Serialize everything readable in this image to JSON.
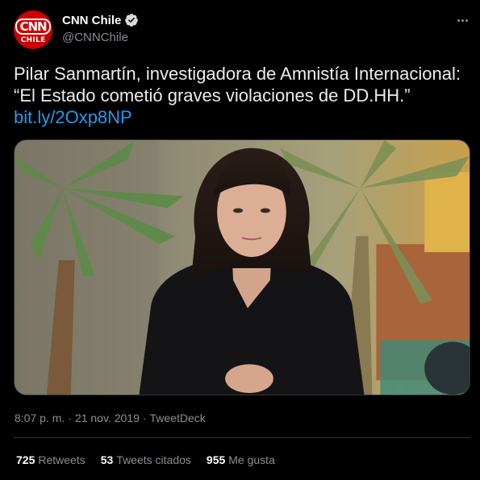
{
  "author": {
    "avatar_text_top": "CNN",
    "avatar_text_bottom": "CHILE",
    "display_name": "CNN Chile",
    "handle": "@CNNChile",
    "verified": true
  },
  "tweet": {
    "text": "Pilar Sanmartín, investigadora de Amnistía Internacional: “El Estado cometió graves violaciones de DD.HH.”",
    "link": "bit.ly/2Oxp8NP"
  },
  "meta": {
    "time": "8:07 p. m.",
    "separator1": "·",
    "date": "21 nov. 2019",
    "separator2": "·",
    "source": "TweetDeck"
  },
  "stats": {
    "retweets_count": "725",
    "retweets_label": "Retweets",
    "quotes_count": "53",
    "quotes_label": "Tweets citados",
    "likes_count": "955",
    "likes_label": "Me gusta"
  },
  "colors": {
    "background": "#000000",
    "link": "#1d9bf0",
    "brand": "#cc0000",
    "muted": "#8a8d91",
    "divider": "#2f3336"
  },
  "icons": {
    "more": "more-horizontal-icon",
    "verified": "verified-badge-icon"
  }
}
